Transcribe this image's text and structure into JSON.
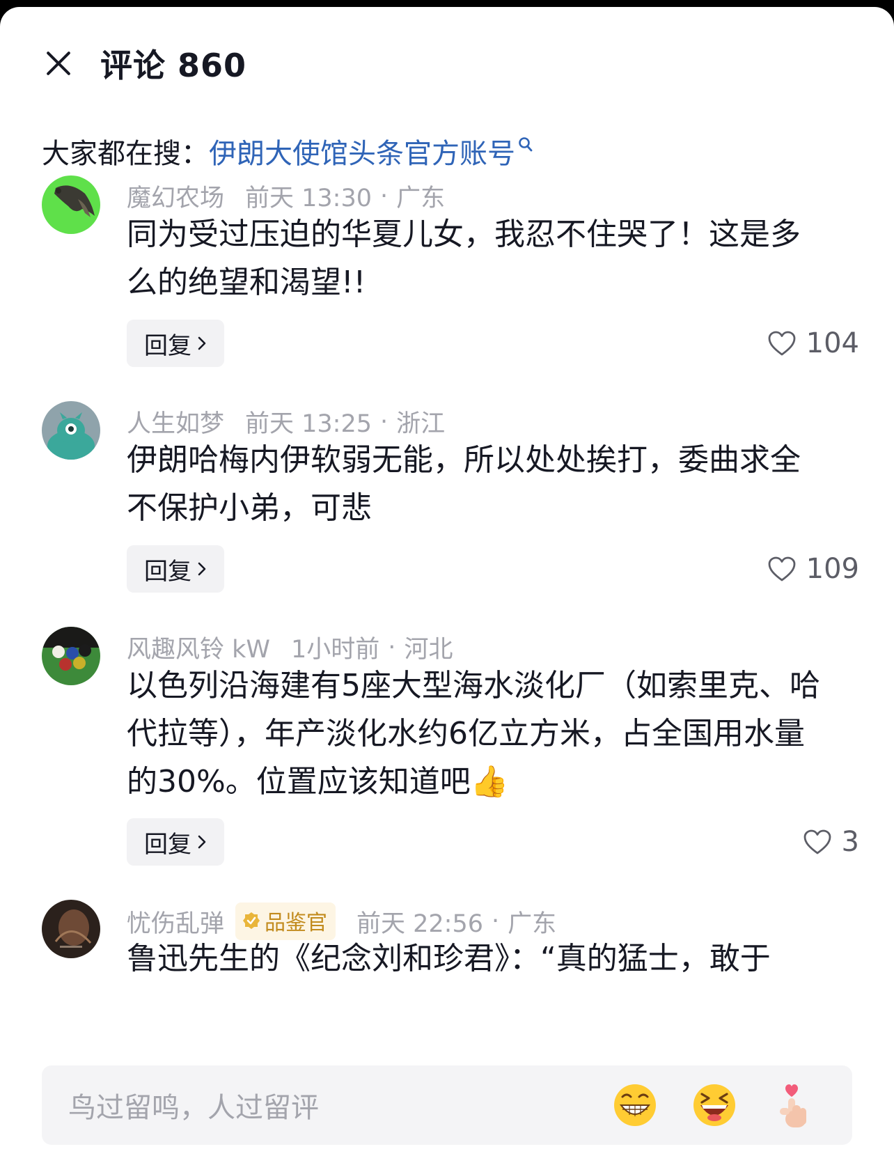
{
  "header": {
    "title": "评论 860"
  },
  "hot_search": {
    "label": "大家都在搜：",
    "query": "伊朗大使馆头条官方账号"
  },
  "comments": [
    {
      "user": "魔幻农场",
      "time": "前天 13:30",
      "location": "广东",
      "text": "同为受过压迫的华夏儿女，我忍不住哭了！这是多么的绝望和渴望!!",
      "reply_label": "回复",
      "likes": "104"
    },
    {
      "user": "人生如梦",
      "time": "前天 13:25",
      "location": "浙江",
      "text": "伊朗哈梅内伊软弱无能，所以处处挨打，委曲求全不保护小弟，可悲",
      "reply_label": "回复",
      "likes": "109"
    },
    {
      "user": "风趣风铃 kW",
      "time": "1小时前",
      "location": "河北",
      "text": "以色列沿海建有5座大型海水淡化厂（如索里克、哈代拉等），年产淡化水约6亿立方米，占全国用水量的30%。位置应该知道吧👍",
      "reply_label": "回复",
      "likes": "3"
    },
    {
      "user": "忧伤乱弹",
      "badge": "品鉴官",
      "time": "前天 22:56",
      "location": "广东",
      "text": "鲁迅先生的《纪念刘和珍君》：“真的猛士，敢于"
    }
  ],
  "separator_dot": "·",
  "input": {
    "placeholder": "鸟过留鸣，人过留评",
    "emojis": [
      "grinning-face",
      "laughing-face",
      "heart-finger"
    ]
  }
}
